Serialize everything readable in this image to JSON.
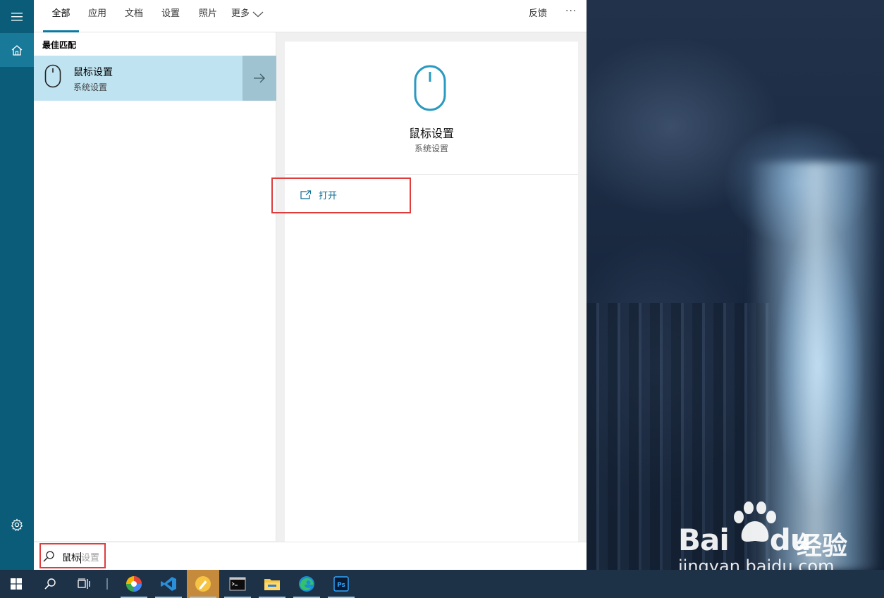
{
  "rail": {
    "menu_icon": "hamburger-icon",
    "home_icon": "home-icon",
    "settings_icon": "gear-icon"
  },
  "tabs": [
    {
      "label": "全部",
      "active": true
    },
    {
      "label": "应用"
    },
    {
      "label": "文档"
    },
    {
      "label": "设置"
    },
    {
      "label": "照片"
    },
    {
      "label": "更多"
    }
  ],
  "header": {
    "feedback": "反馈",
    "more": "···"
  },
  "best_match": {
    "section": "最佳匹配",
    "title": "鼠标设置",
    "subtitle": "系统设置"
  },
  "detail": {
    "title": "鼠标设置",
    "subtitle": "系统设置",
    "open_label": "打开"
  },
  "search": {
    "typed": "鼠标",
    "suggestion": "设置"
  },
  "taskbar": {
    "items": [
      "start-icon",
      "search-icon",
      "task-view-icon",
      "color-picker-app-icon",
      "vscode-icon",
      "notes-app-icon",
      "terminal-icon",
      "file-explorer-icon",
      "edge-icon",
      "photoshop-icon"
    ]
  },
  "watermark": {
    "brand_left": "Bai",
    "brand_right": "du",
    "brand_cn": "经验",
    "url": "jingyan.baidu.com"
  },
  "colors": {
    "accent": "#0a7aa0",
    "rail": "#0a5c78",
    "best_match_bg": "#bfe3f1",
    "highlight_box": "#e03c3c",
    "taskbar": "#1d3147"
  }
}
